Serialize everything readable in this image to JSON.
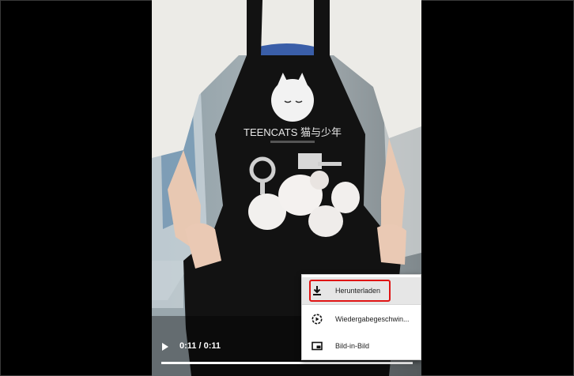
{
  "player": {
    "time_display": "0:11 / 0:11",
    "progress": 1.0,
    "play_icon": "play-icon"
  },
  "video_content": {
    "apron_brand": "TEENCATS",
    "apron_brand_cn": "猫与少年"
  },
  "context_menu": {
    "items": [
      {
        "label": "Herunterladen",
        "icon": "download-icon"
      },
      {
        "label": "Wiedergabegeschwin...",
        "icon": "playback-speed-icon"
      },
      {
        "label": "Bild-in-Bild",
        "icon": "picture-in-picture-icon"
      }
    ]
  },
  "colors": {
    "highlight": "#e01414",
    "menu_bg": "#ffffff",
    "page_bg": "#000000"
  }
}
